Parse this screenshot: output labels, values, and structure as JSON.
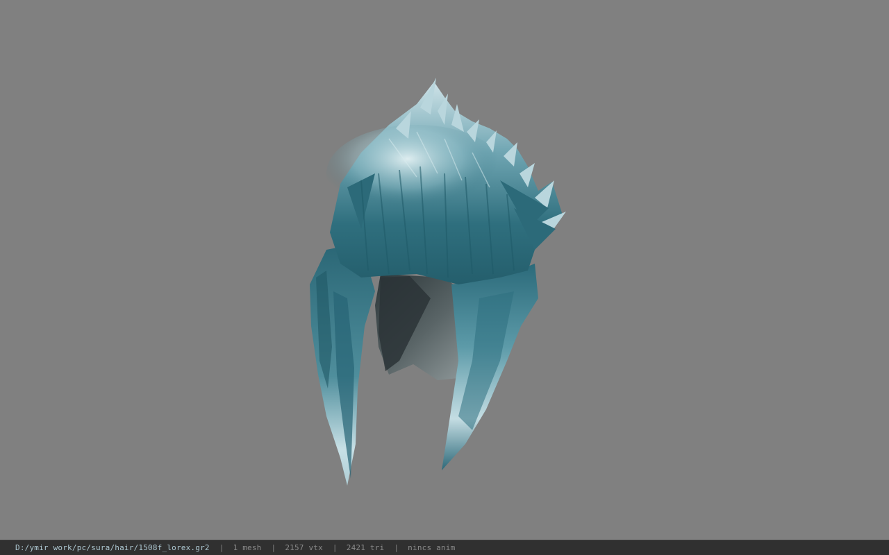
{
  "viewport": {
    "background": "#808080",
    "model": {
      "icon": "hair-mesh-icon",
      "colors": {
        "shadow": "#1a4f5c",
        "base": "#2f6f7e",
        "highlight": "#d2e6ea",
        "inner": "#5b6466"
      }
    }
  },
  "status_bar": {
    "file_path": "D:/ymir work/pc/sura/hair/1508f_lorex.gr2",
    "separator": "|",
    "mesh_count": "1 mesh",
    "vertex_count": "2157 vtx",
    "triangle_count": "2421 tri",
    "anim_status": "nincs anim"
  }
}
